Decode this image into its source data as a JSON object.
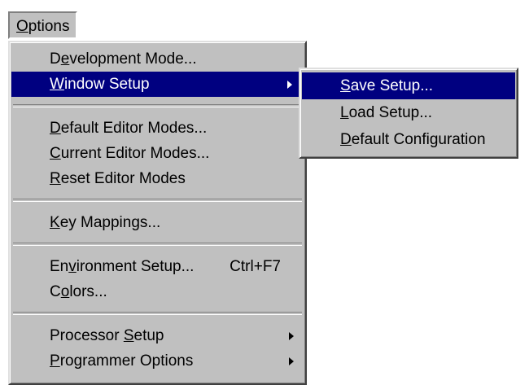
{
  "menubar": {
    "options": {
      "pre": "",
      "key": "O",
      "post": "ptions"
    }
  },
  "main_menu": {
    "items": [
      {
        "pre": "D",
        "key": "e",
        "post": "velopment Mode...",
        "shortcut": ""
      },
      {
        "pre": "",
        "key": "W",
        "post": "indow Setup",
        "shortcut": ""
      },
      {
        "pre": "",
        "key": "D",
        "post": "efault Editor Modes...",
        "shortcut": ""
      },
      {
        "pre": "",
        "key": "C",
        "post": "urrent Editor Modes...",
        "shortcut": ""
      },
      {
        "pre": "",
        "key": "R",
        "post": "eset Editor Modes",
        "shortcut": ""
      },
      {
        "pre": "",
        "key": "K",
        "post": "ey Mappings...",
        "shortcut": ""
      },
      {
        "pre": "En",
        "key": "v",
        "post": "ironment Setup...",
        "shortcut": "Ctrl+F7"
      },
      {
        "pre": "C",
        "key": "o",
        "post": "lors...",
        "shortcut": ""
      },
      {
        "pre": "Processor ",
        "key": "S",
        "post": "etup",
        "shortcut": ""
      },
      {
        "pre": "",
        "key": "P",
        "post": "rogrammer Options",
        "shortcut": ""
      }
    ]
  },
  "sub_menu": {
    "items": [
      {
        "pre": "",
        "key": "S",
        "post": "ave Setup..."
      },
      {
        "pre": "",
        "key": "L",
        "post": "oad Setup..."
      },
      {
        "pre": "",
        "key": "D",
        "post": "efault Configuration"
      }
    ]
  },
  "colors": {
    "menu_bg": "#c0c0c0",
    "highlight_bg": "#000080",
    "highlight_text": "#ffffff",
    "text": "#000000"
  },
  "icons": {
    "submenu_arrow": "triangle-right-icon"
  }
}
